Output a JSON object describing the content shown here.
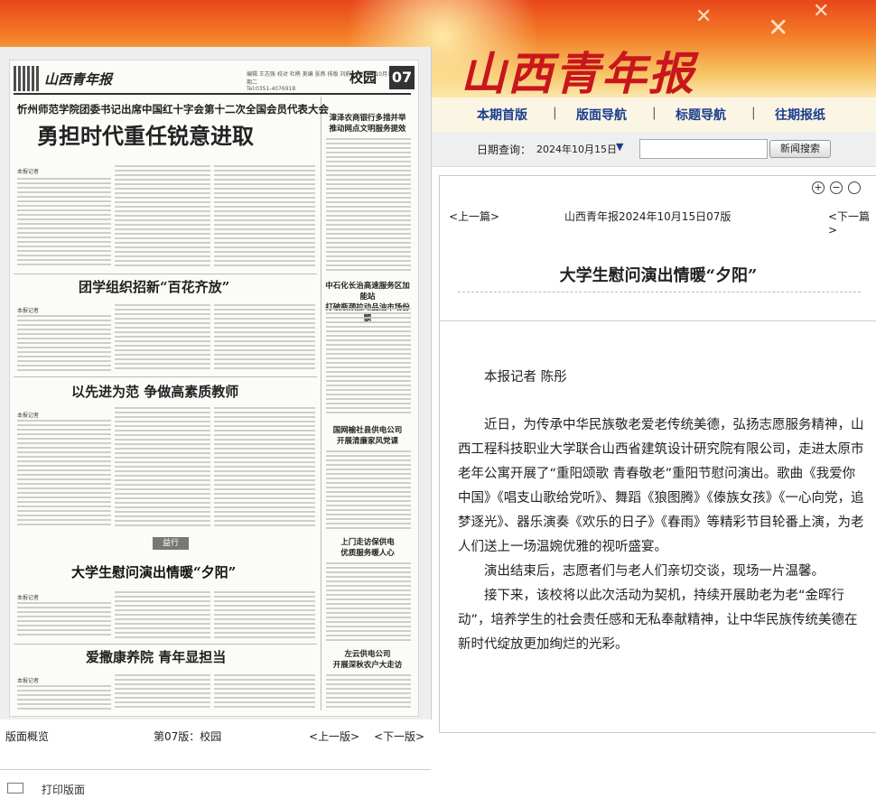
{
  "banner": {
    "logo": "山西青年报"
  },
  "paper": {
    "header_logo": "山西青年报",
    "header_info": "编辑 王志强  校对 杜鹃  美编 张燕  排版 刘蔚 · 2024年10月15日  星期二",
    "header_tel": "Tel:0351-4076918",
    "section": "校园",
    "page_num": "07",
    "h1_sub": "忻州师范学院团委书记出席中国红十字会第十二次全国会员代表大会",
    "h1": "勇担时代重任锐意进取",
    "h2_1": "团学组织招新“百花齐放”",
    "h2_2": "以先进为范 争做高素质教师",
    "h2_3": "大学生慰问演出情暖“夕阳”",
    "h2_4": "爱撒康养院 青年显担当",
    "side_1": "漳泽农商银行多措并举\n推动网点文明服务提效",
    "side_2": "中石化长治高速服务区加能站\n打破瓶颈拉动品油市场份额",
    "side_3": "国网榆社县供电公司\n开展清廉家风党课",
    "side_4": "上门走访保供电\n优质服务暖人心",
    "side_5": "左云供电公司\n开展深秋农户大走访",
    "byline": "本报记者",
    "stamp": "益行"
  },
  "bottom": {
    "overview": "版面概览",
    "page_label": "第07版：校园",
    "prev": "<上一版>",
    "next": "<下一版>",
    "print": "打印版面"
  },
  "nav": {
    "items": [
      "本期首版",
      "版面导航",
      "标题导航",
      "往期报纸"
    ],
    "separator": "|"
  },
  "datebar": {
    "label": "日期查询：",
    "value": "2024年10月15日",
    "arrow": "▼",
    "search_value": "",
    "search_button": "新闻搜索"
  },
  "article": {
    "zoom_in": "+",
    "zoom_out": "−",
    "zoom_reset": "○",
    "prev": "<上一篇>",
    "crumb": "山西青年报2024年10月15日07版",
    "next": "<下一篇>",
    "title": "大学生慰问演出情暖“夕阳”",
    "author": "本报记者  陈彤",
    "paragraphs": [
      "近日，为传承中华民族敬老爱老传统美德，弘扬志愿服务精神，山西工程科技职业大学联合山西省建筑设计研究院有限公司，走进太原市老年公寓开展了“重阳颂歌 青春敬老”重阳节慰问演出。歌曲《我爱你中国》《唱支山歌给党听》、舞蹈《狼图腾》《傣族女孩》《一心向党，追梦逐光》、器乐演奏《欢乐的日子》《春雨》等精彩节目轮番上演，为老人们送上一场温婉优雅的视听盛宴。",
      "演出结束后，志愿者们与老人们亲切交谈，现场一片温馨。",
      "接下来，该校将以此次活动为契机，持续开展助老为老“金晖行动”，培养学生的社会责任感和无私奉献精神，让中华民族传统美德在新时代绽放更加绚烂的光彩。"
    ]
  },
  "colors": {
    "nav_link": "#1a3d8f",
    "logo_red": "#c8161d"
  }
}
